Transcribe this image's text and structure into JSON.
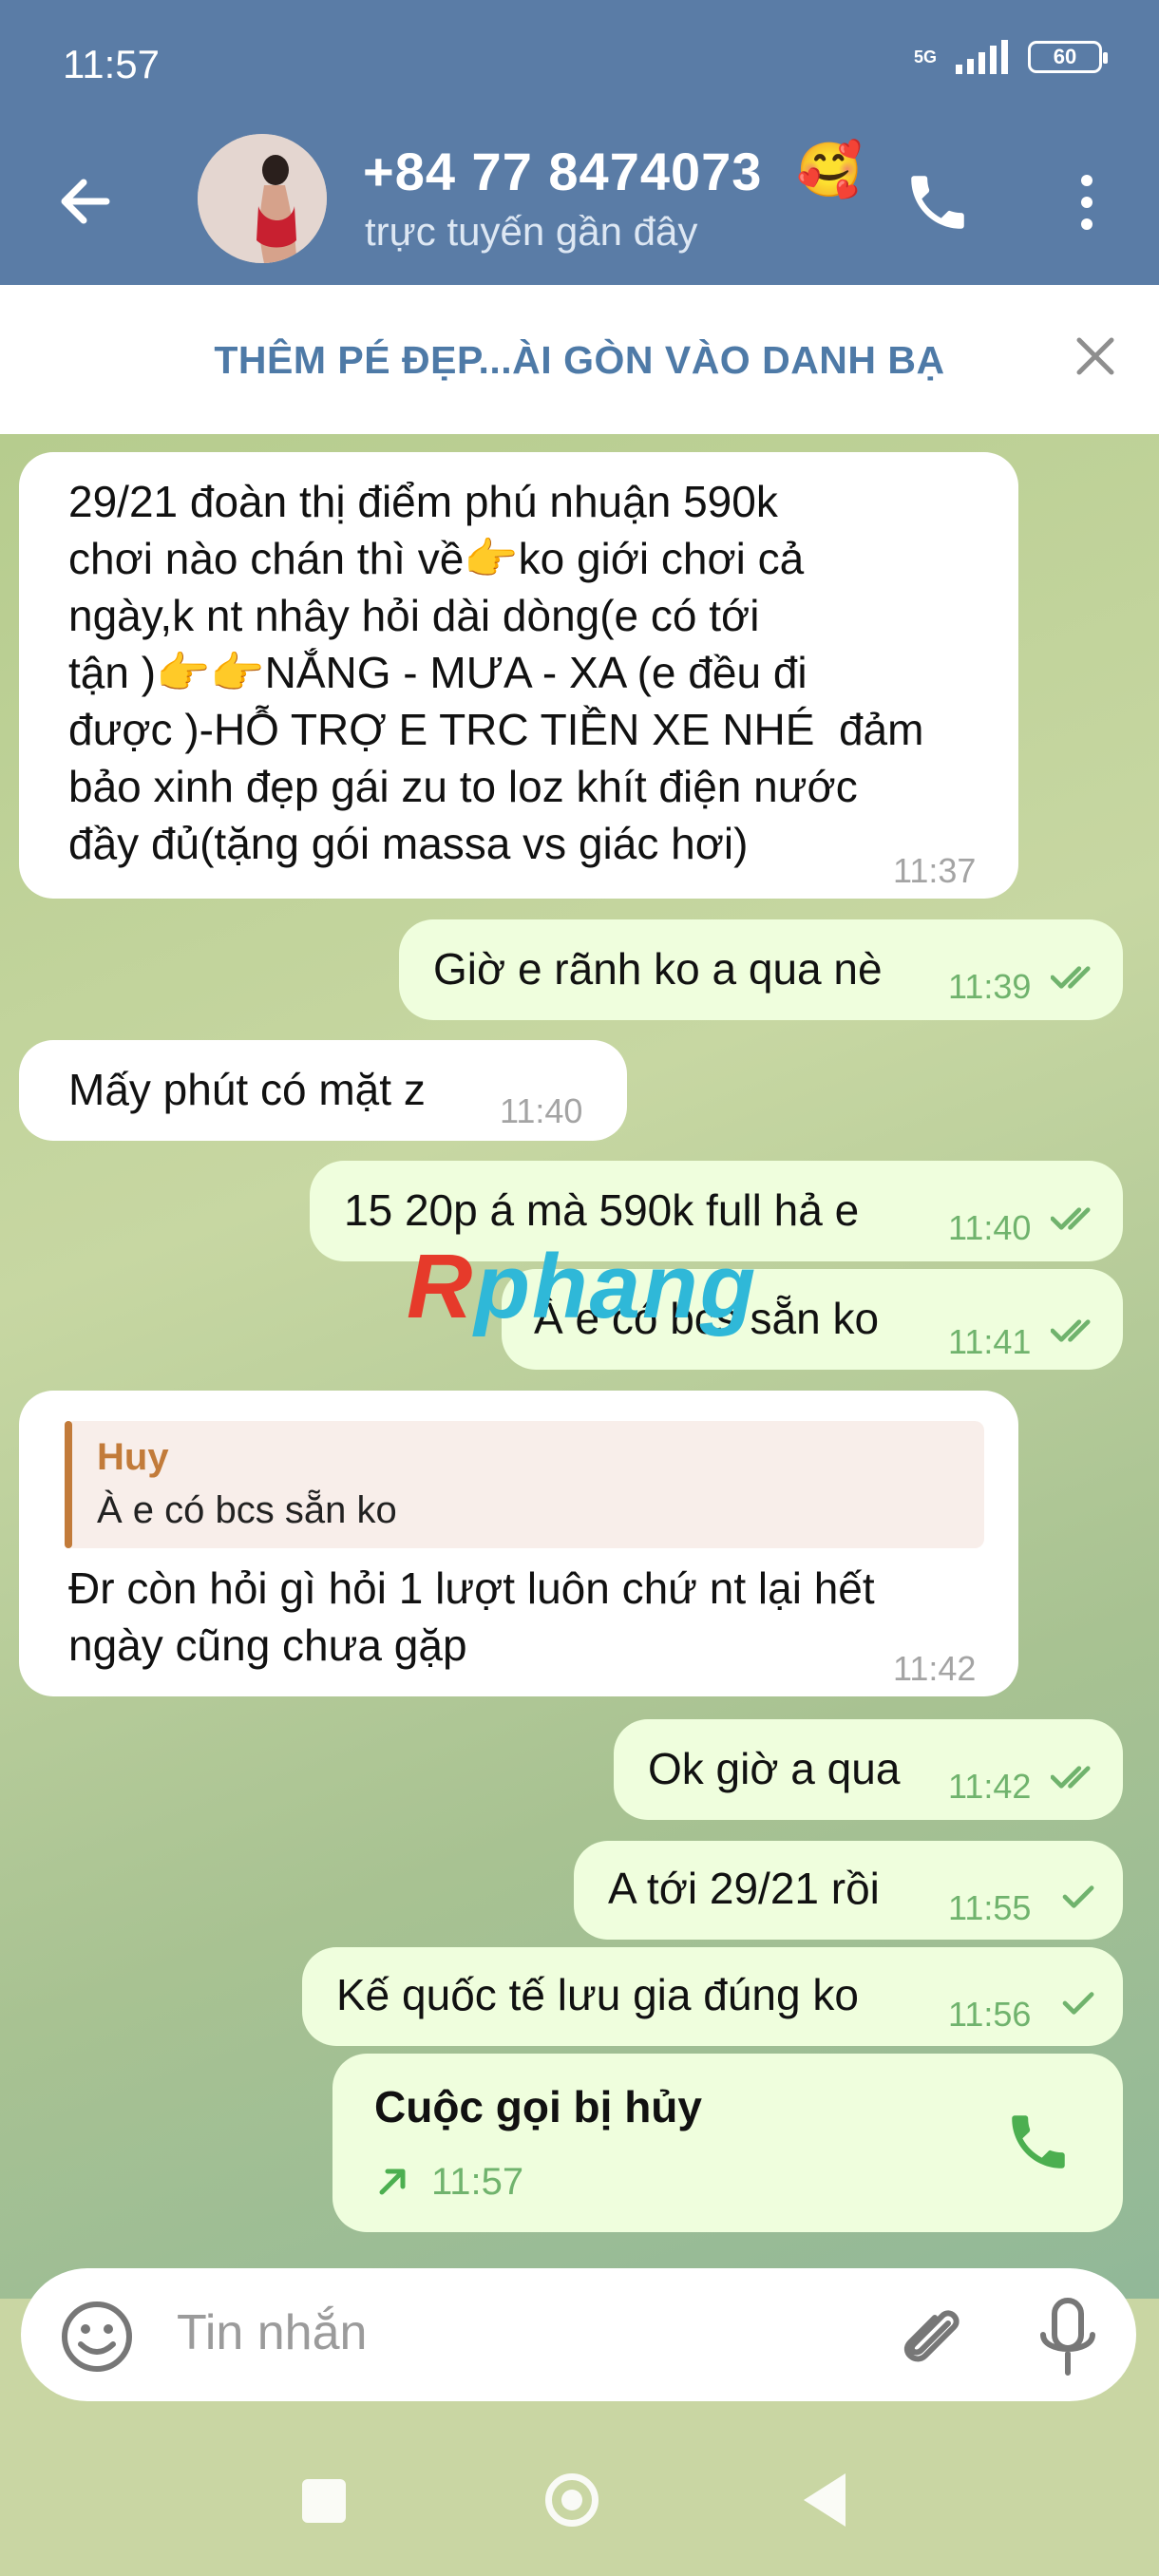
{
  "status_bar": {
    "time": "11:57",
    "network": "5G",
    "battery": "60"
  },
  "header": {
    "contact_name": "+84 77 8474073",
    "contact_emoji": "🥰",
    "contact_status": "trực tuyến gần đây",
    "icons": {
      "back": "arrow-left-icon",
      "call": "phone-icon",
      "menu": "more-vertical-icon"
    }
  },
  "banner": {
    "label": "THÊM PÉ ĐẸP...ÀI GÒN VÀO DANH BẠ",
    "close_icon": "close-icon"
  },
  "watermark": {
    "first": "R",
    "rest": "phang"
  },
  "messages": [
    {
      "dir": "in",
      "lines": [
        "29/21 đoàn thị điểm phú nhuận 590k",
        "chơi nào chán thì về👉ko giới chơi cả",
        "ngày,k nt nhây hỏi dài dòng(e có tới",
        "tận )👉👉NẮNG - MƯA - XA (e đều đi",
        "được )-HỖ TRỢ E TRC TIỀN XE NHÉ  đảm",
        "bảo xinh đẹp gái zu to loz khít điện nước",
        "đầy đủ(tặng gói massa vs giác hơi)"
      ],
      "time": "11:37"
    },
    {
      "dir": "out",
      "text": "Giờ e rãnh ko a qua nè",
      "time": "11:39",
      "status": "read"
    },
    {
      "dir": "in",
      "text": "Mấy phút có mặt z",
      "time": "11:40"
    },
    {
      "dir": "out",
      "text": "15 20p á mà 590k full hả e",
      "time": "11:40",
      "status": "read"
    },
    {
      "dir": "out",
      "text": "À e có bcs sẵn ko",
      "time": "11:41",
      "status": "read"
    },
    {
      "dir": "in",
      "reply_name": "Huy",
      "reply_text": "À e có bcs sẵn ko",
      "lines": [
        "Đr còn hỏi gì hỏi 1 lượt luôn chứ nt lại hết",
        "ngày cũng chưa gặp"
      ],
      "time": "11:42"
    },
    {
      "dir": "out",
      "text": "Ok giờ a qua",
      "time": "11:42",
      "status": "read"
    },
    {
      "dir": "out",
      "text": "A tới 29/21 rồi",
      "time": "11:55",
      "status": "sent"
    },
    {
      "dir": "out",
      "text": "Kế quốc tế lưu gia đúng ko",
      "time": "11:56",
      "status": "sent"
    },
    {
      "dir": "out",
      "call_title": "Cuộc gọi bị hủy",
      "time": "11:57",
      "call_icon": "phone-icon",
      "direction_icon": "arrow-up-right-icon"
    }
  ],
  "input": {
    "placeholder": "Tin nhắn",
    "icons": [
      "emoji-icon",
      "paperclip-icon",
      "microphone-icon"
    ]
  },
  "colors": {
    "header": "#5a7ca6",
    "banner_text": "#4e7aa7",
    "outgoing_bubble": "#effedd",
    "incoming_bubble": "#ffffff",
    "time_out": "#70b36d",
    "reply_accent": "#c27b3a"
  }
}
